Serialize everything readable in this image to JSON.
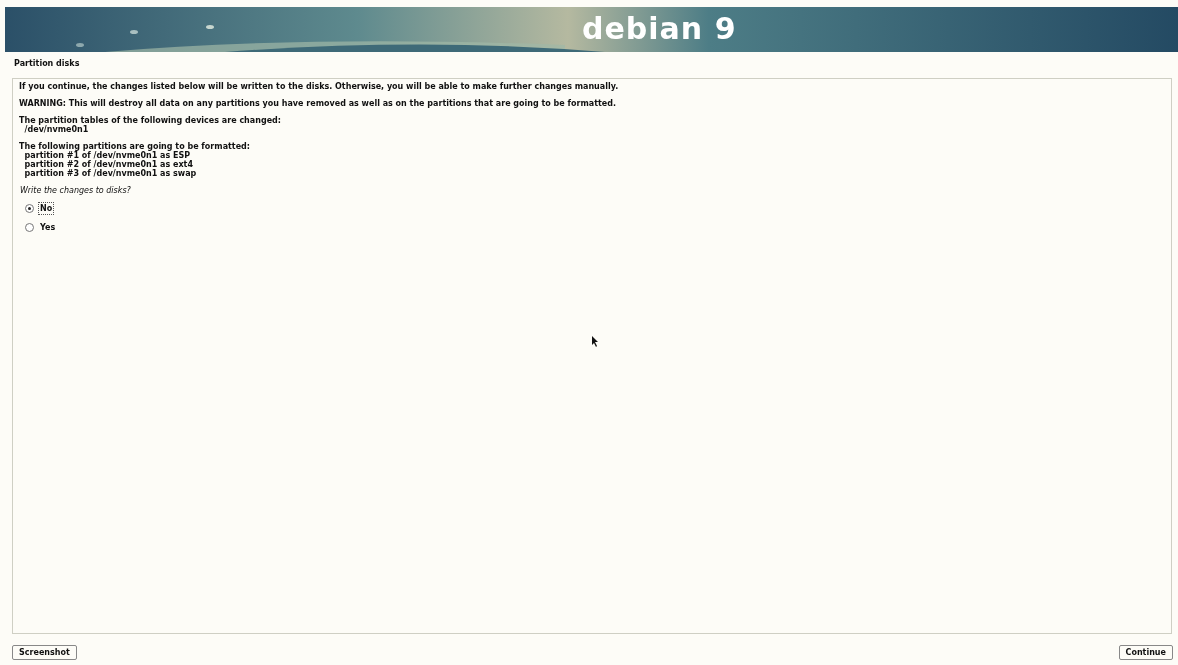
{
  "banner": {
    "logo_text": "debian 9"
  },
  "title": "Partition disks",
  "paragraphs": [
    {
      "lines": [
        "If you continue, the changes listed below will be written to the disks. Otherwise, you will be able to make further changes manually."
      ]
    },
    {
      "lines": [
        "WARNING: This will destroy all data on any partitions you have removed as well as on the partitions that are going to be formatted."
      ]
    },
    {
      "lines": [
        "The partition tables of the following devices are changed:",
        "  /dev/nvme0n1"
      ]
    },
    {
      "lines": [
        "The following partitions are going to be formatted:",
        "  partition #1 of /dev/nvme0n1 as ESP",
        "  partition #2 of /dev/nvme0n1 as ext4",
        "  partition #3 of /dev/nvme0n1 as swap"
      ]
    }
  ],
  "question": "Write the changes to disks?",
  "options": [
    {
      "label": "No",
      "selected": true,
      "focused": true
    },
    {
      "label": "Yes",
      "selected": false,
      "focused": false
    }
  ],
  "buttons": [
    {
      "label": "Screenshot",
      "kind": "left"
    },
    {
      "label": "Continue",
      "kind": "right"
    }
  ]
}
